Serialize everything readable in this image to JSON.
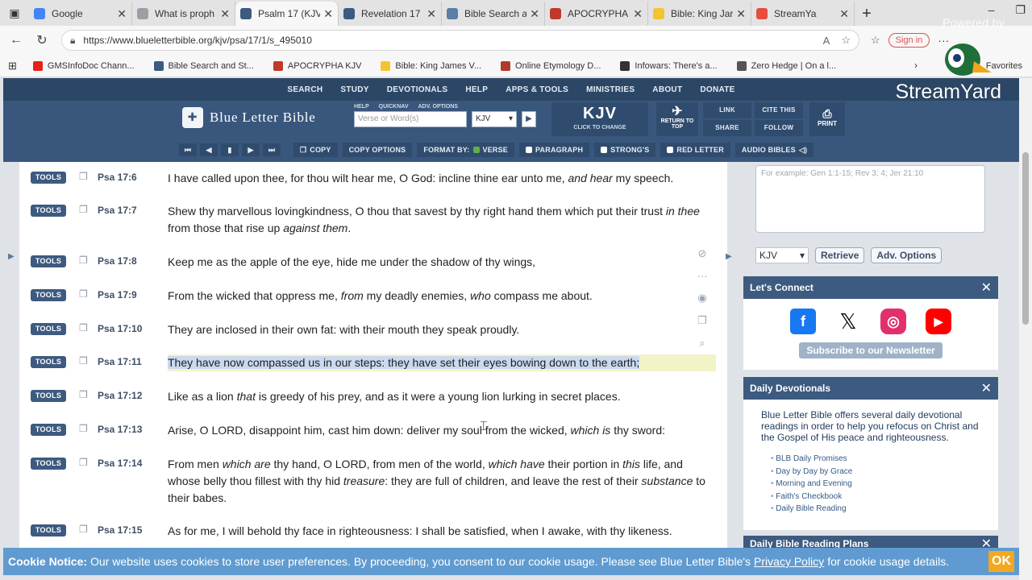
{
  "browser": {
    "tabs": [
      {
        "label": "Google",
        "color": "#4285f4",
        "active": false
      },
      {
        "label": "What is proph",
        "color": "#9aa0a6",
        "active": false
      },
      {
        "label": "Psalm 17 (KJV",
        "color": "#3d5a80",
        "active": true
      },
      {
        "label": "Revelation 17",
        "color": "#3d5a80",
        "active": false
      },
      {
        "label": "Bible Search a",
        "color": "#5c7fa6",
        "active": false
      },
      {
        "label": "APOCRYPHA",
        "color": "#c0392b",
        "active": false
      },
      {
        "label": "Bible: King Jar",
        "color": "#f4c430",
        "active": false
      },
      {
        "label": "StreamYa",
        "color": "#e74c3c",
        "active": false
      }
    ],
    "url": "https://www.blueletterbible.org/kjv/psa/17/1/s_495010",
    "signin_label": "Sign in",
    "bookmarks": [
      {
        "label": "GMSInfoDoc Chann...",
        "color": "#e62117"
      },
      {
        "label": "Bible Search and St...",
        "color": "#3d5a80"
      },
      {
        "label": "APOCRYPHA KJV",
        "color": "#c0392b"
      },
      {
        "label": "Bible: King James V...",
        "color": "#f4c430"
      },
      {
        "label": "Online Etymology D...",
        "color": "#b03a2e"
      },
      {
        "label": "Infowars: There's a...",
        "color": "#333333"
      },
      {
        "label": "Zero Hedge | On a l...",
        "color": "#555555"
      }
    ],
    "favorites_label": "Favorites"
  },
  "streamyard": {
    "powered": "Powered by",
    "logo": "StreamYard"
  },
  "blb": {
    "topnav": [
      "SEARCH",
      "STUDY",
      "DEVOTIONALS",
      "HELP",
      "APPS & TOOLS",
      "MINISTRIES",
      "ABOUT",
      "DONATE"
    ],
    "brand": "Blue Letter Bible",
    "smallopts": [
      "HELP",
      "QUICKNAV",
      "ADV. OPTIONS"
    ],
    "search_placeholder": "Verse or Word(s)",
    "version": "KJV",
    "kjv_big": "KJV",
    "kjv_small": "CLICK TO CHANGE",
    "return_label": "RETURN TO TOP",
    "link": "LINK",
    "share": "SHARE",
    "cite": "CITE THIS",
    "follow": "FOLLOW",
    "print": "PRINT",
    "toolbar": {
      "copy": "COPY",
      "copy_options": "COPY OPTIONS",
      "format_by": "FORMAT BY:",
      "verse": "VERSE",
      "paragraph": "PARAGRAPH",
      "strongs": "STRONG'S",
      "red_letter": "RED LETTER",
      "audio": "AUDIO BIBLES"
    }
  },
  "verses": [
    {
      "ref": "Psa 17:6",
      "html": "I have called upon thee, for thou wilt hear me, O God: incline thine ear unto me, <i>and hear</i> my speech.",
      "highlight": false
    },
    {
      "ref": "Psa 17:7",
      "html": "Shew thy marvellous lovingkindness, O thou that savest by thy right hand them which put their trust <i>in thee</i> from those that rise up <i>against them</i>.",
      "highlight": false
    },
    {
      "ref": "Psa 17:8",
      "html": "Keep me as the apple of the eye, hide me under the shadow of thy wings,",
      "highlight": false
    },
    {
      "ref": "Psa 17:9",
      "html": "From the wicked that oppress me, <i>from</i> my deadly enemies, <i>who</i> compass me about.",
      "highlight": false
    },
    {
      "ref": "Psa 17:10",
      "html": "They are inclosed in their own fat: with their mouth they speak proudly.",
      "highlight": false
    },
    {
      "ref": "Psa 17:11",
      "html": "<span>They have now compassed us in our steps: they have set their eyes bowing down to the earth;</span>",
      "highlight": true
    },
    {
      "ref": "Psa 17:12",
      "html": "Like as a lion <i>that</i> is greedy of his prey, and as it were a young lion lurking in secret places.",
      "highlight": false
    },
    {
      "ref": "Psa 17:13",
      "html": "Arise, O LORD, disappoint him, cast him down: deliver my soul from the wicked, <i>which is</i> thy sword:",
      "highlight": false
    },
    {
      "ref": "Psa 17:14",
      "html": "From men <i>which are</i> thy hand, O LORD, from men of the world, <i>which have</i> their portion in <i>this</i> life, and whose belly thou fillest with thy hid <i>treasure</i>: they are full of children, and leave the rest of their <i>substance</i> to their babes.",
      "highlight": false
    },
    {
      "ref": "Psa 17:15",
      "html": "As for me, I will behold thy face in righteousness: I shall be satisfied, when I awake, with thy likeness.",
      "highlight": false
    }
  ],
  "tools_label": "TOOLS",
  "sidebar": {
    "ref_placeholder": "For example: Gen 1:1-15; Rev 3; 4; Jer 21:10",
    "ref_version": "KJV",
    "retrieve": "Retrieve",
    "adv_options": "Adv. Options",
    "connect_title": "Let's Connect",
    "newsletter": "Subscribe to our Newsletter",
    "devo_title": "Daily Devotionals",
    "devo_text": "Blue Letter Bible offers several daily devotional readings in order to help you refocus on Christ and the Gospel of His peace and righteousness.",
    "devo_items": [
      "BLB Daily Promises",
      "Day by Day by Grace",
      "Morning and Evening",
      "Faith's Checkbook",
      "Daily Bible Reading"
    ],
    "plans_title": "Daily Bible Reading Plans"
  },
  "cookie": {
    "title": "Cookie Notice:",
    "text": "Our website uses cookies to store user preferences. By proceeding, you consent to our cookie usage. Please see Blue Letter Bible's",
    "link": "Privacy Policy",
    "tail": "for cookie usage details.",
    "ok": "OK"
  }
}
